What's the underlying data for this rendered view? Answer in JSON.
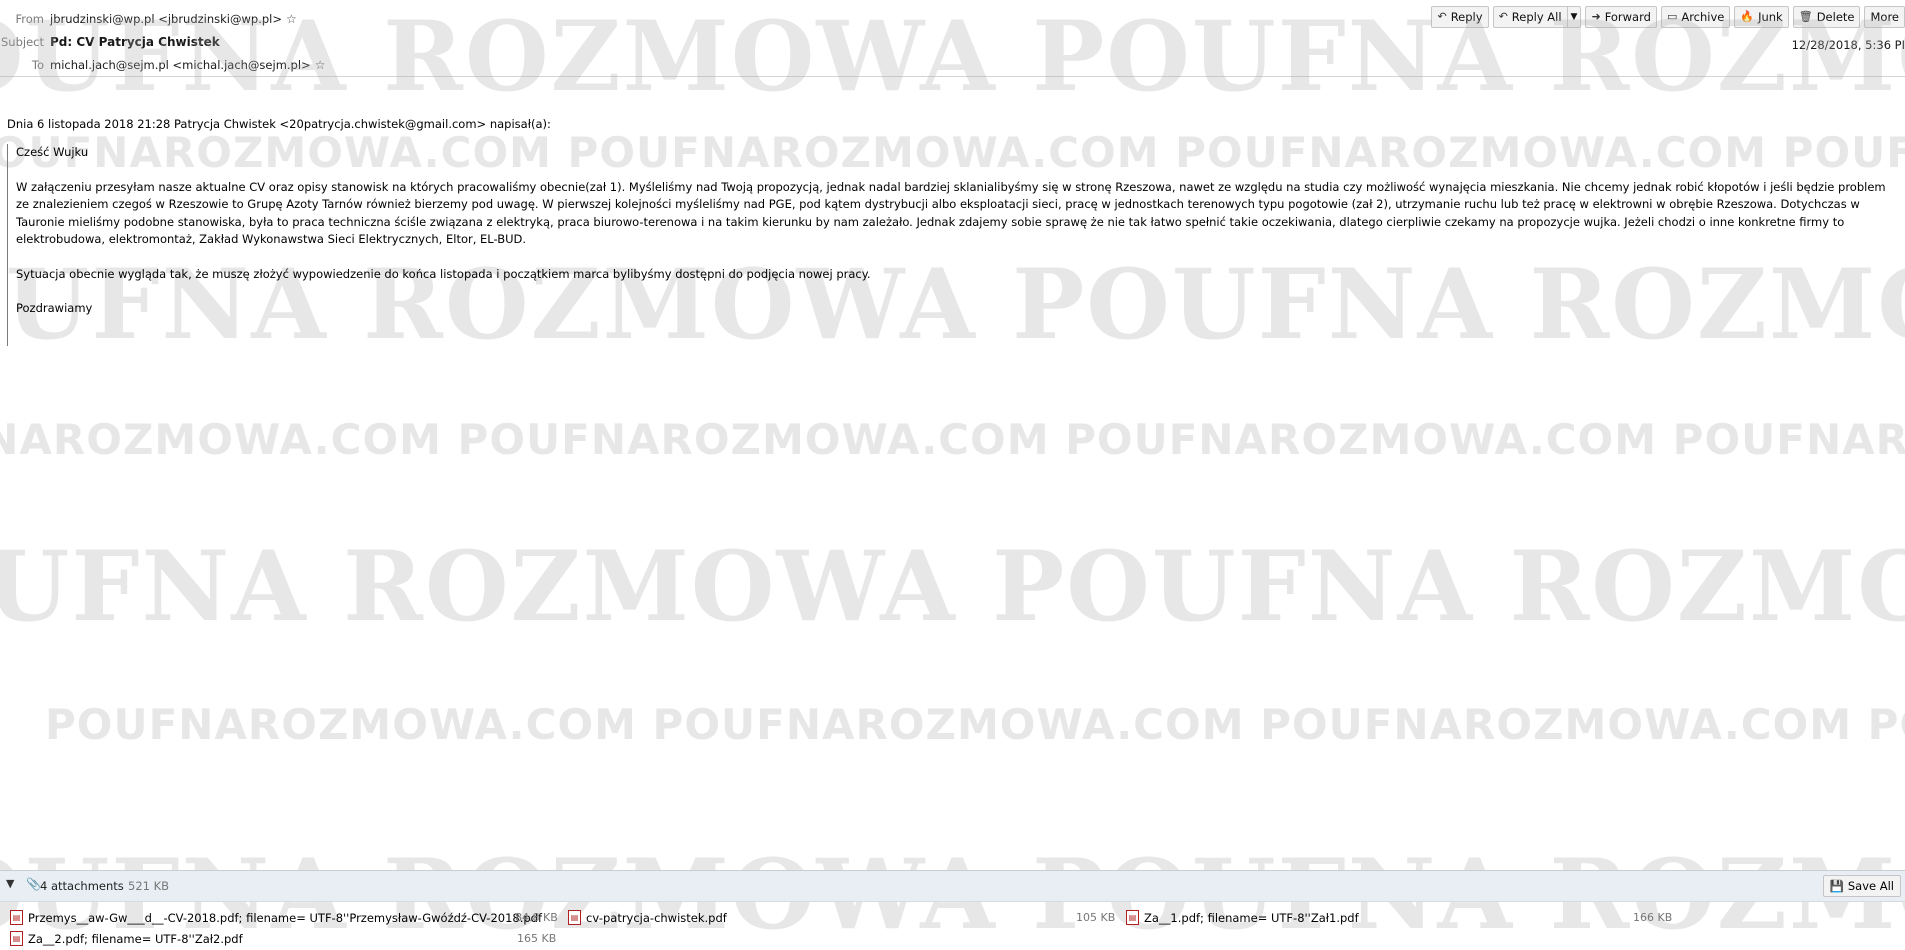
{
  "header": {
    "from_label": "From",
    "from_value": "jbrudzinski@wp.pl <jbrudzinski@wp.pl>",
    "subject_label": "Subject",
    "subject_value": "Pd: CV Patrycja Chwistek",
    "to_label": "To",
    "to_value": "michal.jach@sejm.pl <michal.jach@sejm.pl>",
    "date": "12/28/2018, 5:36 PI",
    "star_icon": "star-icon"
  },
  "toolbar": {
    "reply": "Reply",
    "reply_all": "Reply All",
    "forward": "Forward",
    "archive": "Archive",
    "junk": "Junk",
    "delete": "Delete",
    "more": "More"
  },
  "message": {
    "intro": "Dnia 6 listopada 2018 21:28 Patrycja Chwistek <20patrycja.chwistek@gmail.com> napisał(a):",
    "greeting": "Cześć Wujku",
    "paragraph1": "W załączeniu przesyłam nasze aktualne CV oraz opisy stanowisk na których pracowaliśmy obecnie(zał 1). Myśleliśmy nad Twoją propozycją, jednak nadal bardziej sklanialibyśmy się w stronę Rzeszowa,  nawet ze względu na studia czy możliwość wynajęcia mieszkania. Nie chcemy jednak robić kłopotów i jeśli będzie problem ze znalezieniem czegoś w Rzeszowie to Grupę Azoty Tarnów  również bierzemy pod uwagę. W pierwszej kolejności myśleliśmy nad PGE, pod kątem dystrybucji albo eksploatacji sieci, pracę w jednostkach terenowych typu pogotowie (zał 2), utrzymanie ruchu lub też pracę w elektrowni w obrębie Rzeszowa. Dotychczas w Tauronie mieliśmy podobne stanowiska, była to praca techniczna ściśle związana z elektryką, praca biurowo-terenowa i na takim kierunku by nam zależało. Jednak zdajemy sobie sprawę że nie tak łatwo spełnić takie oczekiwania, dlatego cierpliwie czekamy na propozycje wujka. Jeżeli chodzi o inne konkretne firmy to elektrobudowa, elektromontaż, Zakład Wykonawstwa Sieci Elektrycznych, Eltor, EL-BUD.",
    "paragraph2": "Sytuacja obecnie wygląda tak, że muszę złożyć wypowiedzenie do końca listopada i początkiem marca bylibyśmy dostępni do podjęcia nowej pracy.",
    "closing": "Pozdrawiamy"
  },
  "watermark": {
    "big": "OUFNA ROZMOWA    POUFNA ROZMOWA",
    "small": "POUFNAROZMOWA.COM    POUFNAROZMOWA.COM    POUFNAROZMOWA.COM    POUFNAROZMOWA.COM"
  },
  "attachments": {
    "count_label": "4 attachments",
    "total_size": "521 KB",
    "save_all": "Save All",
    "items": [
      {
        "name": "Przemys__aw-Gw___d__-CV-2018.pdf; filename= UTF-8''Przemysław-Gwóźdź-CV-2018.pdf",
        "size": "84.8 KB"
      },
      {
        "name": "cv-patrycja-chwistek.pdf",
        "size": "105 KB"
      },
      {
        "name": "Za__1.pdf; filename= UTF-8''Zał1.pdf",
        "size": "166 KB"
      },
      {
        "name": "Za__2.pdf; filename= UTF-8''Zał2.pdf",
        "size": "165 KB"
      }
    ]
  }
}
